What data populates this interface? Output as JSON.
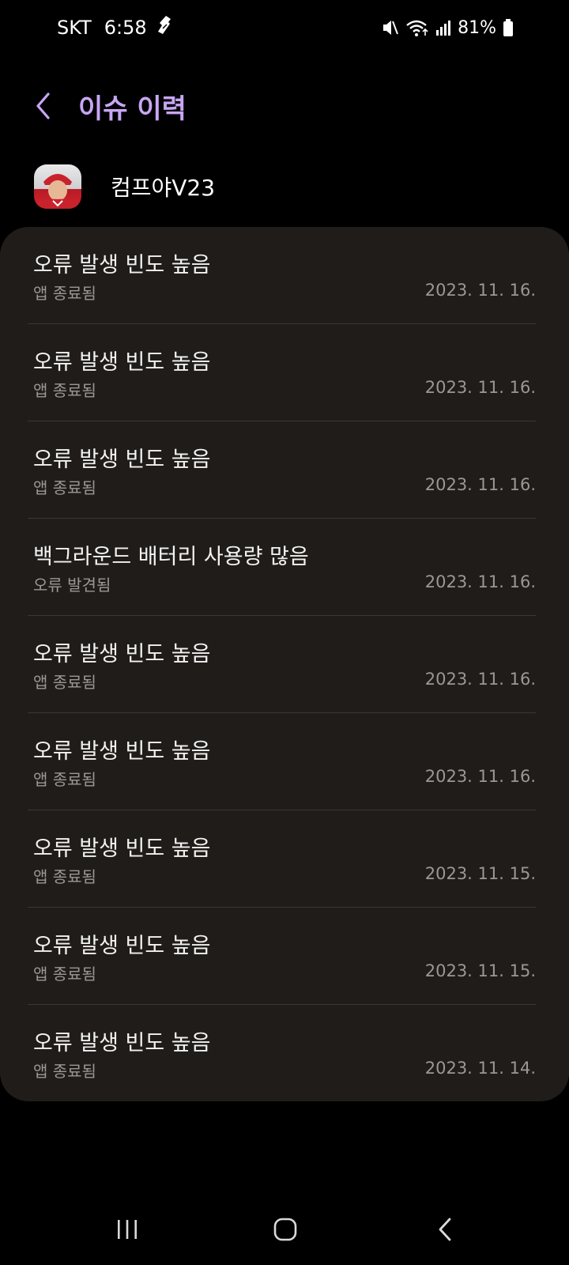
{
  "status_bar": {
    "carrier": "SKT",
    "time": "6:58",
    "battery": "81%",
    "icons": [
      "notification-icon",
      "mute-icon",
      "wifi-icon",
      "signal-icon",
      "battery-icon"
    ]
  },
  "header": {
    "title": "이슈 이력",
    "back_icon": "back-arrow-icon"
  },
  "app": {
    "name": "컴프야V23",
    "icon": "app-icon"
  },
  "issues": [
    {
      "title": "오류 발생 빈도 높음",
      "subtitle": "앱 종료됨",
      "date": "2023. 11. 16."
    },
    {
      "title": "오류 발생 빈도 높음",
      "subtitle": "앱 종료됨",
      "date": "2023. 11. 16."
    },
    {
      "title": "오류 발생 빈도 높음",
      "subtitle": "앱 종료됨",
      "date": "2023. 11. 16."
    },
    {
      "title": "백그라운드 배터리 사용량 많음",
      "subtitle": "오류 발견됨",
      "date": "2023. 11. 16."
    },
    {
      "title": "오류 발생 빈도 높음",
      "subtitle": "앱 종료됨",
      "date": "2023. 11. 16."
    },
    {
      "title": "오류 발생 빈도 높음",
      "subtitle": "앱 종료됨",
      "date": "2023. 11. 16."
    },
    {
      "title": "오류 발생 빈도 높음",
      "subtitle": "앱 종료됨",
      "date": "2023. 11. 15."
    },
    {
      "title": "오류 발생 빈도 높음",
      "subtitle": "앱 종료됨",
      "date": "2023. 11. 15."
    },
    {
      "title": "오류 발생 빈도 높음",
      "subtitle": "앱 종료됨",
      "date": "2023. 11. 14."
    }
  ],
  "nav_bar": {
    "icons": [
      "recent-apps-icon",
      "home-icon",
      "nav-back-icon"
    ]
  },
  "colors": {
    "background": "#000000",
    "card": "#201c19",
    "accent": "#c8a6f4",
    "divider": "#3b3735",
    "secondary_text": "#9b9894"
  }
}
